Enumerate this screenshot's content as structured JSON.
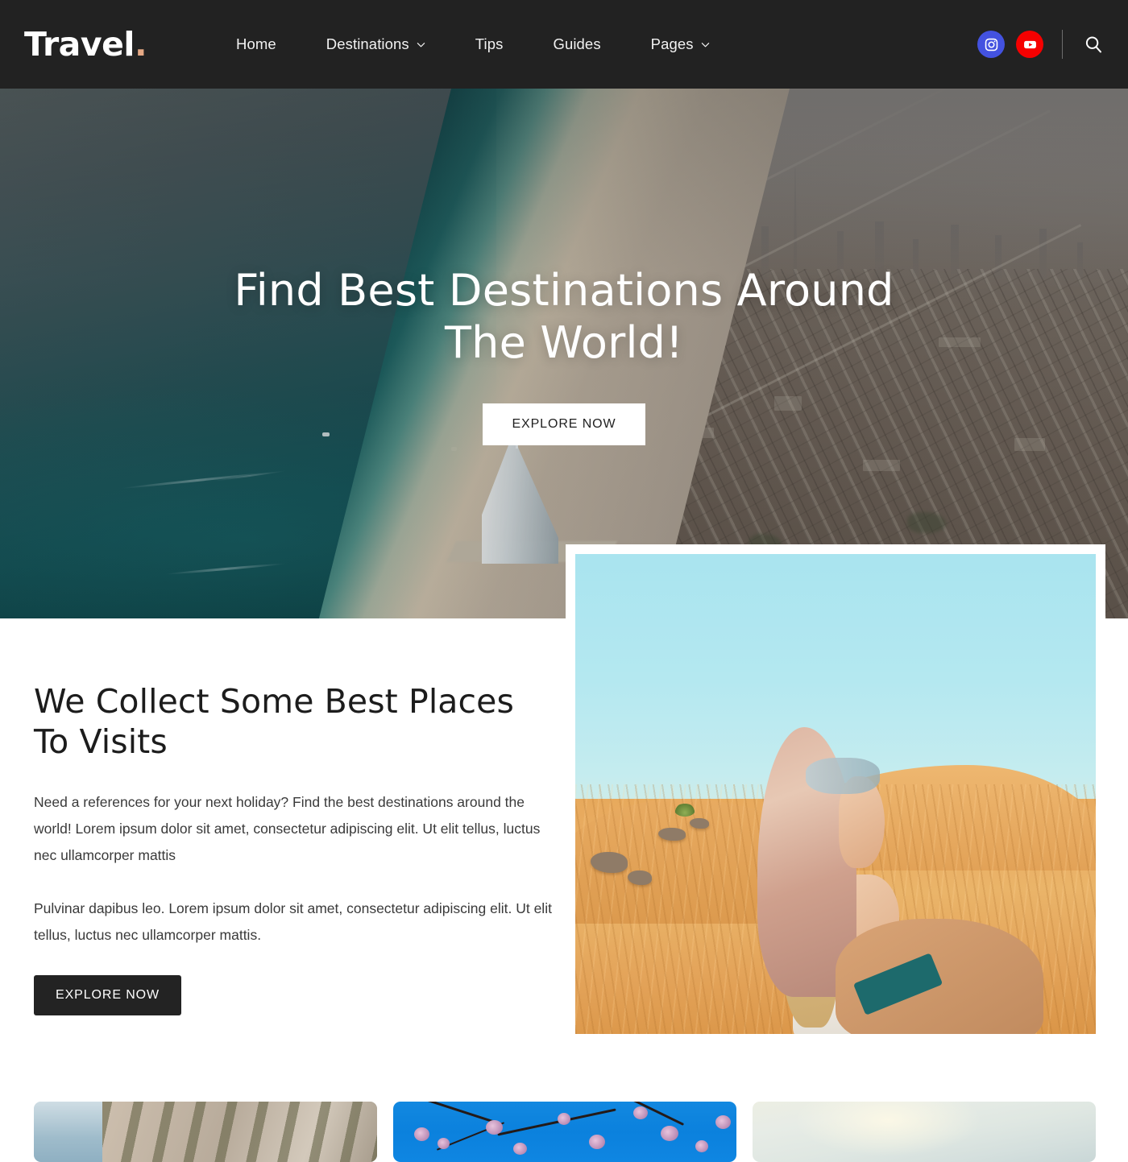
{
  "header": {
    "logo_text": "Travel",
    "logo_dot": ".",
    "nav": [
      {
        "label": "Home",
        "has_chevron": false
      },
      {
        "label": "Destinations",
        "has_chevron": true
      },
      {
        "label": "Tips",
        "has_chevron": false
      },
      {
        "label": "Guides",
        "has_chevron": false
      },
      {
        "label": "Pages",
        "has_chevron": true
      }
    ],
    "social": [
      {
        "name": "instagram",
        "color": "#4352e0"
      },
      {
        "name": "youtube",
        "color": "#f50000"
      }
    ],
    "search_label": "Search",
    "background": "#222222"
  },
  "hero": {
    "title_line1": "Find Best Destinations Around",
    "title_line2": "The World!",
    "button_label": "EXPLORE NOW",
    "image_alt": "Aerial view of Dubai coastline with Burj Al Arab"
  },
  "feature": {
    "title": "We Collect Some Best Places To Visits",
    "paragraph1": "Need a references for your next holiday? Find the best destinations around the world! Lorem ipsum dolor sit amet, consectetur adipiscing elit. Ut elit tellus, luctus nec ullamcorper mattis",
    "paragraph2": "Pulvinar dapibus leo. Lorem ipsum dolor sit amet, consectetur adipiscing elit. Ut elit tellus, luctus nec ullamcorper mattis.",
    "button_label": "EXPLORE NOW",
    "image_alt": "Woman in headscarf leading by the hand across desert sand dunes"
  },
  "cards": [
    {
      "alt": "Coastal cliffs above blue sea"
    },
    {
      "alt": "Cherry blossom branches against blue sky"
    },
    {
      "alt": "Pale overcast sky"
    }
  ],
  "colors": {
    "header_bg": "#222222",
    "accent_dot": "#e6a985",
    "dark_button": "#232323",
    "instagram": "#4352e0",
    "youtube": "#f50000",
    "body_text": "#3a3a3a",
    "heading_text": "#1c1c1c"
  }
}
